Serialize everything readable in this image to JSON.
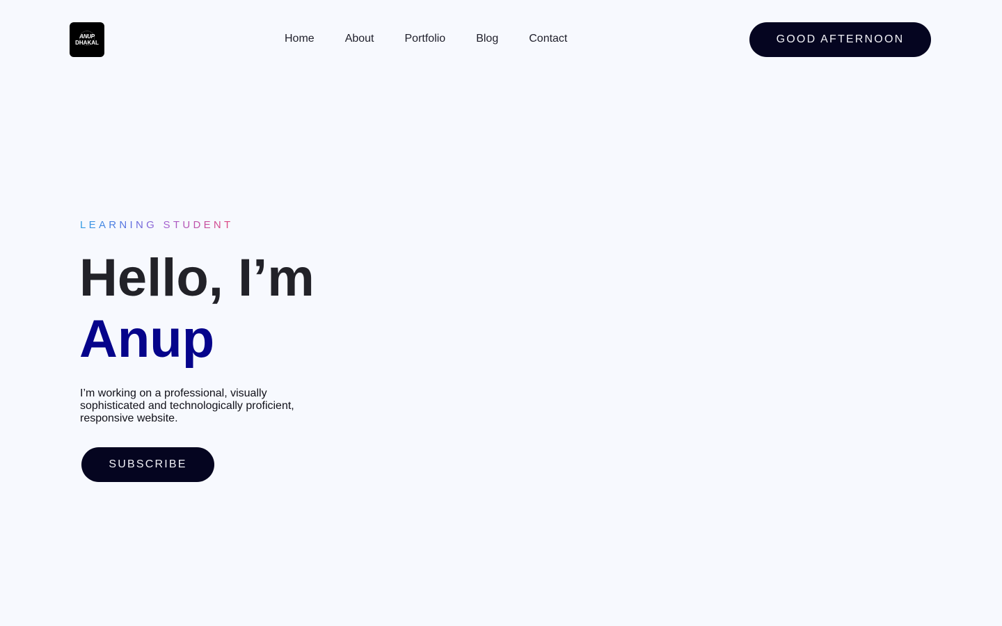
{
  "header": {
    "logo": {
      "line1": "ANUP",
      "line2": "DHAKAL"
    },
    "nav": [
      {
        "label": "Home"
      },
      {
        "label": "About"
      },
      {
        "label": "Portfolio"
      },
      {
        "label": "Blog"
      },
      {
        "label": "Contact"
      }
    ],
    "greeting_button": "GOOD AFTERNOON"
  },
  "hero": {
    "eyebrow": "LEARNING STUDENT",
    "headline": "Hello, I’m",
    "name": "Anup",
    "description": "I’m working on a professional, visually sophisticated and technologically proficient, responsive website.",
    "cta_label": "SUBSCRIBE"
  },
  "colors": {
    "background": "#f7f9fe",
    "button_bg": "#050520",
    "name_accent": "#06048b",
    "eyebrow_gradient_start": "#2f9ce4",
    "eyebrow_gradient_end": "#e0467c"
  }
}
